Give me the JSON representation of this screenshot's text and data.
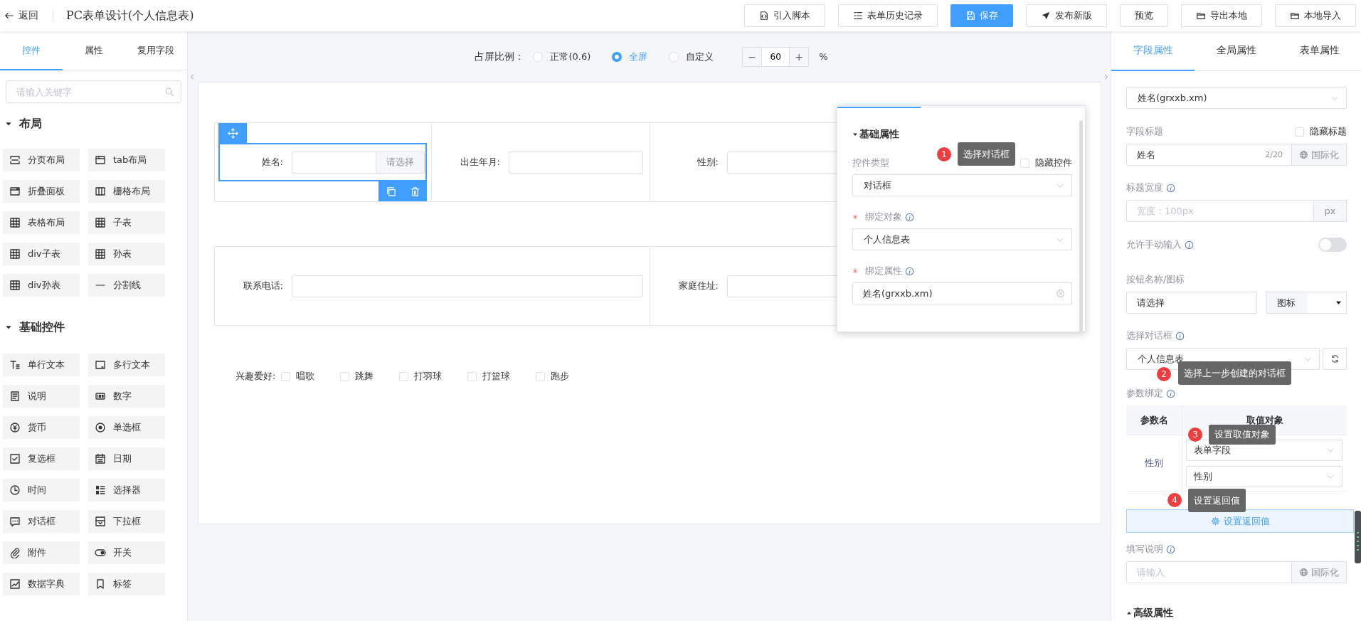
{
  "header": {
    "back": "返回",
    "title": "PC表单设计(个人信息表)",
    "buttons": [
      {
        "label": "引入脚本",
        "primary": false
      },
      {
        "label": "表单历史记录",
        "primary": false
      },
      {
        "label": "保存",
        "primary": true
      },
      {
        "label": "发布新版",
        "primary": false
      },
      {
        "label": "预览",
        "primary": false
      },
      {
        "label": "导出本地",
        "primary": false
      },
      {
        "label": "本地导入",
        "primary": false
      }
    ]
  },
  "left_panel": {
    "tabs": [
      {
        "label": "控件",
        "selected": true
      },
      {
        "label": "属性",
        "selected": false
      },
      {
        "label": "复用字段",
        "selected": false
      }
    ],
    "search": {
      "placeholder": "请输入关键字"
    },
    "sections": [
      {
        "title": "布局",
        "expanded": true,
        "items": [
          "分页布局",
          "tab布局",
          "折叠面板",
          "栅格布局",
          "表格布局",
          "子表",
          "div子表",
          "孙表",
          "div孙表",
          "分割线"
        ]
      },
      {
        "title": "基础控件",
        "expanded": true,
        "items": [
          "单行文本",
          "多行文本",
          "说明",
          "数字",
          "货币",
          "单选框",
          "复选框",
          "日期",
          "时间",
          "选择器",
          "对话框",
          "下拉框",
          "附件",
          "开关",
          "数据字典",
          "标签"
        ]
      }
    ]
  },
  "canvas": {
    "ratio": {
      "label": "占屏比例：",
      "options": [
        {
          "label": "正常(0.6)",
          "selected": false
        },
        {
          "label": "全屏",
          "selected": true
        },
        {
          "label": "自定义",
          "selected": false
        }
      ],
      "decrement": "−",
      "value": "60",
      "increment": "+",
      "unit": "%"
    },
    "field_rows": [
      {
        "fields": [
          {
            "label": "姓名:",
            "selected": true,
            "button": "请选择"
          },
          {
            "label": "出生年月:",
            "selected": false
          },
          {
            "label": "性别:",
            "selected": false
          }
        ]
      },
      {
        "fields": [
          {
            "label": "联系电话:",
            "selected": false
          },
          {
            "label": "家庭住址:",
            "selected": false
          }
        ]
      }
    ],
    "hobbies": {
      "label": "兴趣爱好:",
      "options": [
        {
          "label": "唱歌",
          "checked": false
        },
        {
          "label": "跳舞",
          "checked": false
        },
        {
          "label": "打羽球",
          "checked": false
        },
        {
          "label": "打篮球",
          "checked": false
        },
        {
          "label": "跑步",
          "checked": false
        }
      ]
    }
  },
  "popup": {
    "section": {
      "title": "基础属性",
      "expanded": true
    },
    "control_type": {
      "label": "控件类型",
      "value": "对话框"
    },
    "hide_control": {
      "label": "隐藏控件",
      "checked": false
    },
    "bind_object": {
      "label": "绑定对象",
      "required": true,
      "value": "个人信息表"
    },
    "bind_property": {
      "label": "绑定属性",
      "required": true,
      "value": "姓名(grxxb.xm)"
    },
    "callout": {
      "number": "1",
      "text": "选择对话框"
    }
  },
  "right_panel": {
    "tabs": [
      {
        "label": "字段属性",
        "selected": true
      },
      {
        "label": "全局属性",
        "selected": false
      },
      {
        "label": "表单属性",
        "selected": false
      }
    ],
    "field_select": "姓名(grxxb.xm)",
    "title_label": "字段标题",
    "hide_title": {
      "label": "隐藏标题",
      "checked": false
    },
    "title_input": {
      "value": "姓名",
      "count": "2/20",
      "i18n": "国际化"
    },
    "width_label": "标题宽度",
    "width_input": {
      "placeholder": "宽度：100px",
      "unit": "px"
    },
    "manual_input": {
      "label": "允许手动输入",
      "on": false
    },
    "button_label": "按钮名称/图标",
    "button_name": "请选择",
    "icon_select": "图标",
    "dialog_label": "选择对话框",
    "dialog_select": "个人信息表",
    "params_label": "参数绑定",
    "params_table": {
      "columns": [
        "参数名",
        "取值对象"
      ],
      "rows": [
        {
          "name": "性别",
          "source": "表单字段",
          "field": "性别"
        }
      ]
    },
    "return_button": "设置返回值",
    "note_label": "填写说明",
    "note_input": {
      "placeholder": "请输入",
      "i18n": "国际化"
    },
    "advanced": {
      "title": "高级属性",
      "expanded": false
    },
    "callouts": [
      {
        "number": "2",
        "text": "选择上一步创建的对话框"
      },
      {
        "number": "3",
        "text": "设置取值对象"
      },
      {
        "number": "4",
        "text": "设置返回值"
      }
    ]
  }
}
